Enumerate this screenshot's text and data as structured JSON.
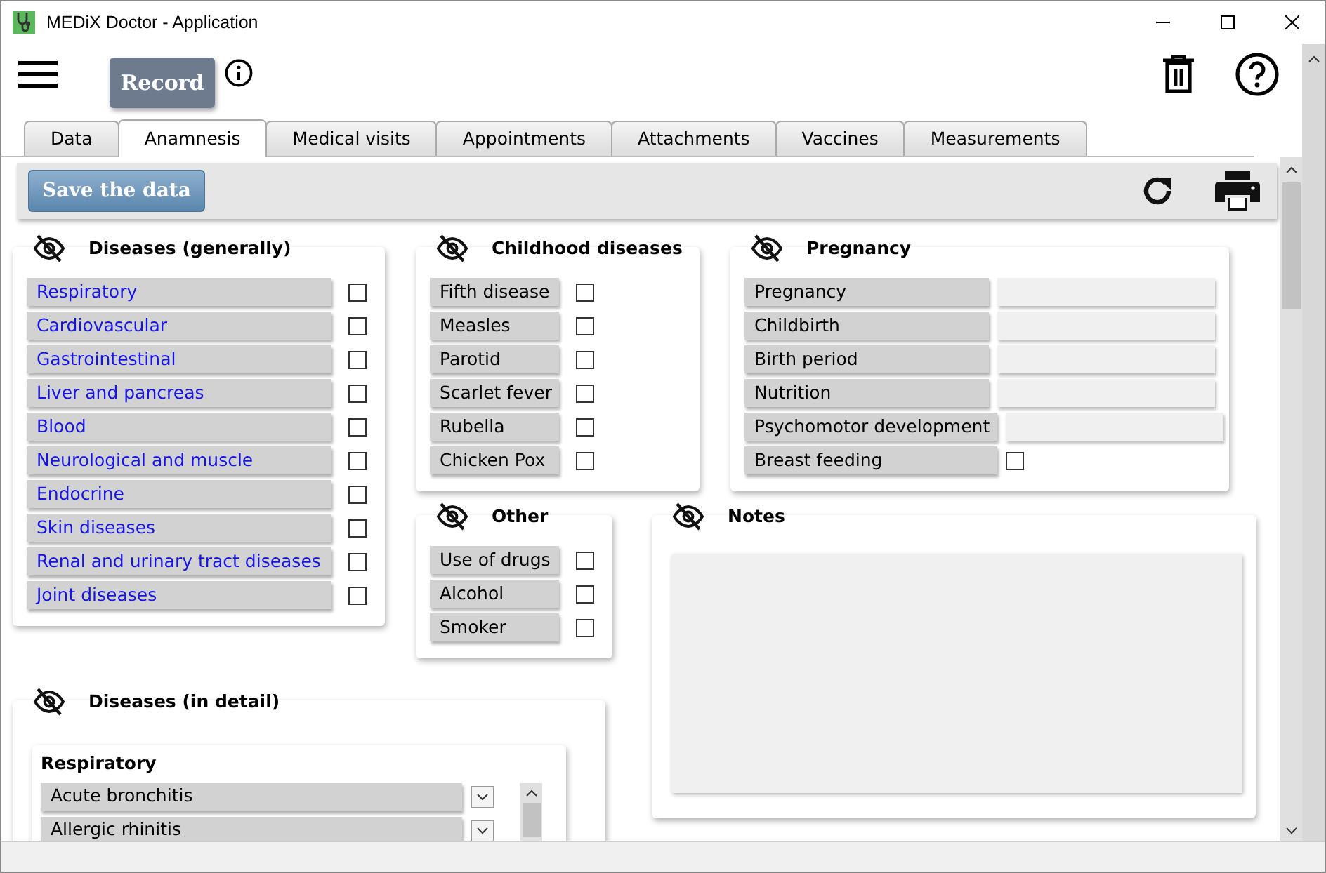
{
  "window": {
    "title": "MEDiX Doctor - Application"
  },
  "app_bar": {
    "record_button": "Record"
  },
  "tabs": [
    {
      "label": "Data",
      "selected": false
    },
    {
      "label": "Anamnesis",
      "selected": true
    },
    {
      "label": "Medical visits",
      "selected": false
    },
    {
      "label": "Appointments",
      "selected": false
    },
    {
      "label": "Attachments",
      "selected": false
    },
    {
      "label": "Vaccines",
      "selected": false
    },
    {
      "label": "Measurements",
      "selected": false
    }
  ],
  "form_toolbar": {
    "save_button": "Save the data"
  },
  "diseases_generally": {
    "title": "Diseases (generally)",
    "items": [
      {
        "label": "Respiratory",
        "checked": false
      },
      {
        "label": "Cardiovascular",
        "checked": false
      },
      {
        "label": "Gastrointestinal",
        "checked": false
      },
      {
        "label": "Liver and pancreas",
        "checked": false
      },
      {
        "label": "Blood",
        "checked": false
      },
      {
        "label": "Neurological and muscle",
        "checked": false
      },
      {
        "label": "Endocrine",
        "checked": false
      },
      {
        "label": "Skin diseases",
        "checked": false
      },
      {
        "label": "Renal and urinary tract diseases",
        "checked": false
      },
      {
        "label": "Joint diseases",
        "checked": false
      }
    ]
  },
  "childhood_diseases": {
    "title": "Childhood diseases",
    "items": [
      {
        "label": "Fifth disease",
        "checked": false
      },
      {
        "label": "Measles",
        "checked": false
      },
      {
        "label": "Parotid",
        "checked": false
      },
      {
        "label": "Scarlet fever",
        "checked": false
      },
      {
        "label": "Rubella",
        "checked": false
      },
      {
        "label": "Chicken Pox",
        "checked": false
      }
    ]
  },
  "pregnancy": {
    "title": "Pregnancy",
    "items": [
      {
        "label": "Pregnancy",
        "kind": "field"
      },
      {
        "label": "Childbirth",
        "kind": "field"
      },
      {
        "label": "Birth period",
        "kind": "field"
      },
      {
        "label": "Nutrition",
        "kind": "field"
      },
      {
        "label": "Psychomotor development",
        "kind": "field"
      },
      {
        "label": "Breast feeding",
        "kind": "checkbox",
        "checked": false
      }
    ]
  },
  "other": {
    "title": "Other",
    "items": [
      {
        "label": "Use of drugs",
        "checked": false
      },
      {
        "label": "Alcohol",
        "checked": false
      },
      {
        "label": "Smoker",
        "checked": false
      }
    ]
  },
  "notes": {
    "title": "Notes"
  },
  "diseases_in_detail": {
    "title": "Diseases (in detail)",
    "groups": [
      {
        "title": "Respiratory",
        "items": [
          {
            "label": "Acute bronchitis"
          },
          {
            "label": "Allergic rhinitis"
          }
        ]
      }
    ]
  }
}
